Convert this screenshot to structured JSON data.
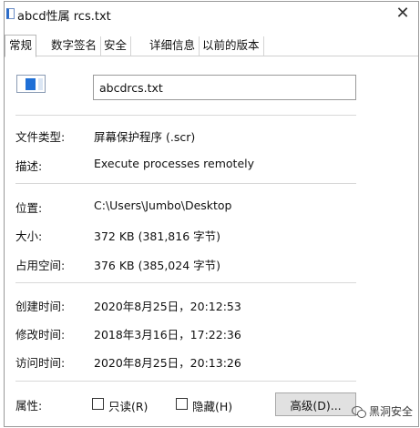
{
  "window": {
    "title": "abcd性属 rcs.txt",
    "close_glyph": "✕"
  },
  "tabs": [
    {
      "label": "常规"
    },
    {
      "label": "数字签名"
    },
    {
      "label": "安全"
    },
    {
      "label": "详细信息"
    },
    {
      "label": "以前的版本"
    }
  ],
  "general": {
    "file_name": "abcdrcs.txt",
    "file_type_label": "文件类型:",
    "file_type_value": "屏幕保护程序 (.scr)",
    "description_label": "描述:",
    "description_value": "Execute processes remotely",
    "location_label": "位置:",
    "location_value": "C:\\Users\\Jumbo\\Desktop",
    "size_label": "大小:",
    "size_value": "372 KB (381,816 字节)",
    "size_on_disk_label": "占用空间:",
    "size_on_disk_value": "376 KB (385,024 字节)",
    "created_label": "创建时间:",
    "created_value": "2020年8月25日，20:12:53",
    "modified_label": "修改时间:",
    "modified_value": "2018年3月16日，17:22:36",
    "accessed_label": "访问时间:",
    "accessed_value": "2020年8月25日，20:13:26",
    "attributes_label": "属性:",
    "readonly_label": "只读(R)",
    "readonly_checked": false,
    "hidden_label": "隐藏(H)",
    "hidden_checked": false,
    "advanced_button": "高级(D)..."
  },
  "watermark": {
    "text": "黑洞安全"
  },
  "icons": {
    "title_icon": "text-file-icon",
    "file_icon": "screensaver-file-icon",
    "watermark_icon": "wechat-icon"
  }
}
